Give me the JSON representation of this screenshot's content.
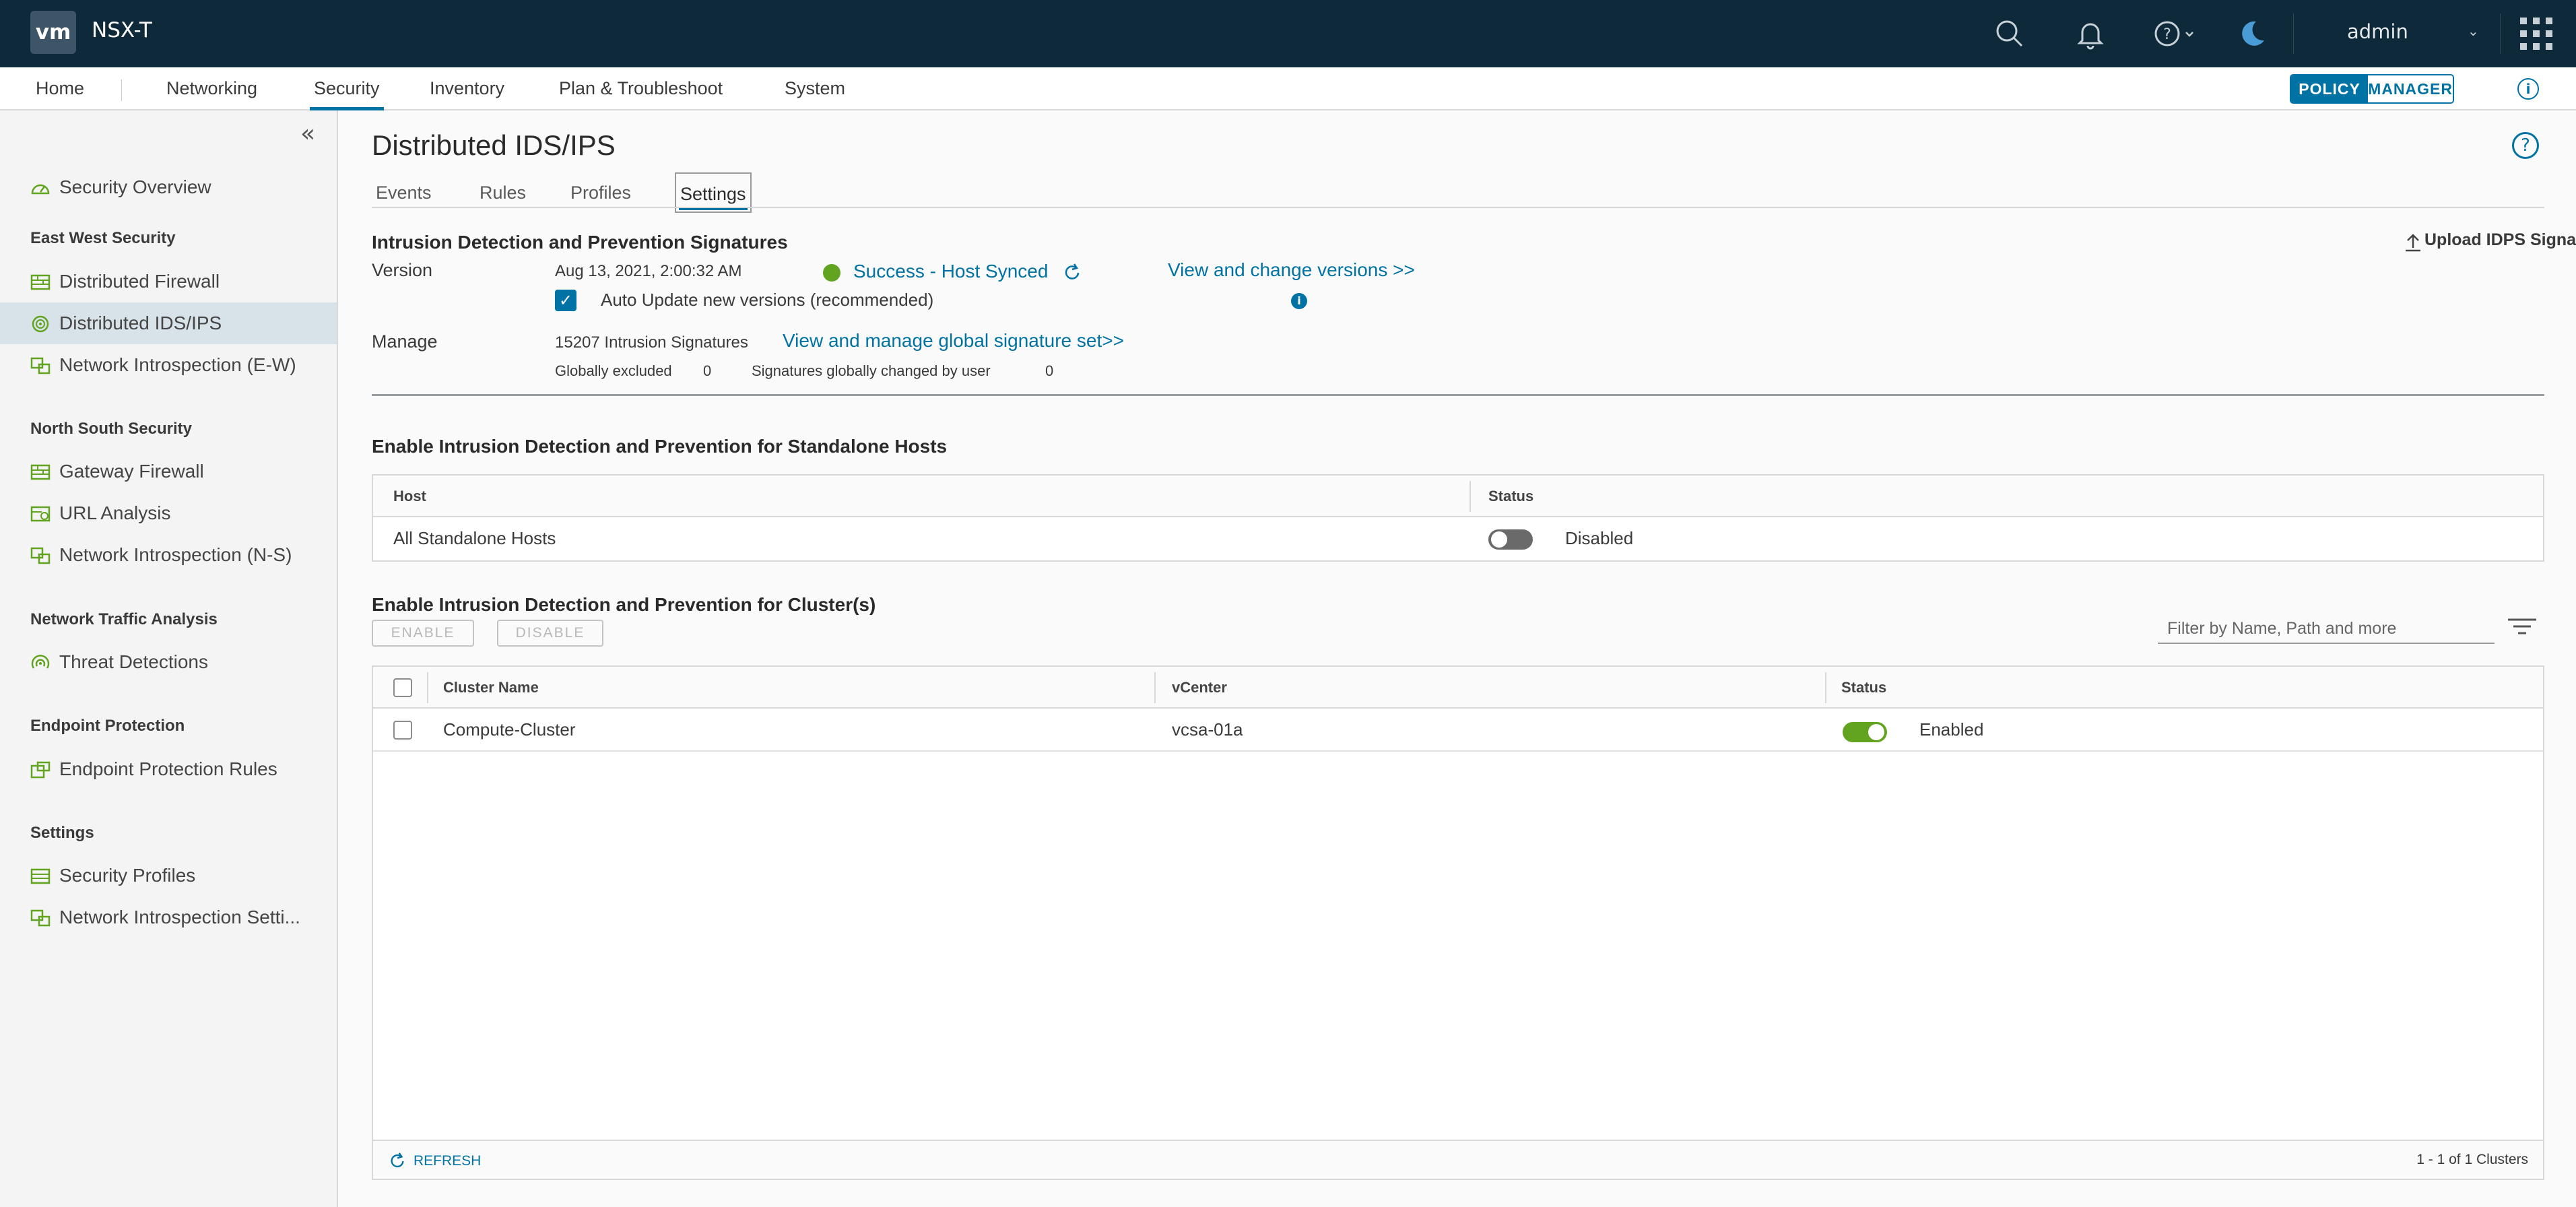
{
  "app": {
    "logo": "vm",
    "product": "NSX-T"
  },
  "header": {
    "user": "admin",
    "icons": [
      "search-icon",
      "bell-icon",
      "help-icon",
      "theme-moon-icon",
      "app-launcher-icon"
    ]
  },
  "nav": {
    "home": "Home",
    "items": [
      "Networking",
      "Security",
      "Inventory",
      "Plan & Troubleshoot",
      "System"
    ],
    "active": "Security",
    "mode_policy": "POLICY",
    "mode_manager": "MANAGER"
  },
  "sidebar": {
    "overview": "Security Overview",
    "sections": [
      {
        "title": "East West Security",
        "items": [
          "Distributed Firewall",
          "Distributed IDS/IPS",
          "Network Introspection (E-W)"
        ]
      },
      {
        "title": "North South Security",
        "items": [
          "Gateway Firewall",
          "URL Analysis",
          "Network Introspection (N-S)"
        ]
      },
      {
        "title": "Network Traffic Analysis",
        "items": [
          "Threat Detections"
        ]
      },
      {
        "title": "Endpoint Protection",
        "items": [
          "Endpoint Protection Rules"
        ]
      },
      {
        "title": "Settings",
        "items": [
          "Security Profiles",
          "Network Introspection Setti..."
        ]
      }
    ],
    "active_item": "Distributed IDS/IPS"
  },
  "page": {
    "title": "Distributed IDS/IPS",
    "tabs": [
      "Events",
      "Rules",
      "Profiles",
      "Settings"
    ],
    "active_tab": "Settings"
  },
  "signatures": {
    "section_title": "Intrusion Detection and Prevention Signatures",
    "upload_label": "Upload IDPS Signatures",
    "version_label": "Version",
    "version_date": "Aug 13, 2021, 2:00:32 AM",
    "status": "Success - Host Synced",
    "status_color": "#62a420",
    "view_versions_link": "View and change versions >>",
    "auto_update_label": "Auto Update new versions (recommended)",
    "auto_update_checked": true,
    "manage_label": "Manage",
    "signature_count": "15207 Intrusion Signatures",
    "manage_link": "View and manage global signature set>>",
    "globally_excluded_label": "Globally excluded",
    "globally_excluded_value": "0",
    "changed_by_user_label": "Signatures globally changed by user",
    "changed_by_user_value": "0"
  },
  "standalone": {
    "section_title": "Enable Intrusion Detection and Prevention for Standalone Hosts",
    "columns": [
      "Host",
      "Status"
    ],
    "rows": [
      {
        "host": "All Standalone Hosts",
        "status": "Disabled",
        "enabled": false
      }
    ]
  },
  "clusters": {
    "section_title": "Enable Intrusion Detection and Prevention for Cluster(s)",
    "enable_btn": "ENABLE",
    "disable_btn": "DISABLE",
    "filter_placeholder": "Filter by Name, Path and more",
    "columns": [
      "Cluster Name",
      "vCenter",
      "Status"
    ],
    "rows": [
      {
        "name": "Compute-Cluster",
        "vcenter": "vcsa-01a",
        "status": "Enabled",
        "enabled": true
      }
    ],
    "refresh_label": "REFRESH",
    "pagination": "1 - 1 of 1 Clusters"
  },
  "colors": {
    "header_bg": "#0e2a3a",
    "accent": "#0072a3",
    "success": "#62a420"
  }
}
